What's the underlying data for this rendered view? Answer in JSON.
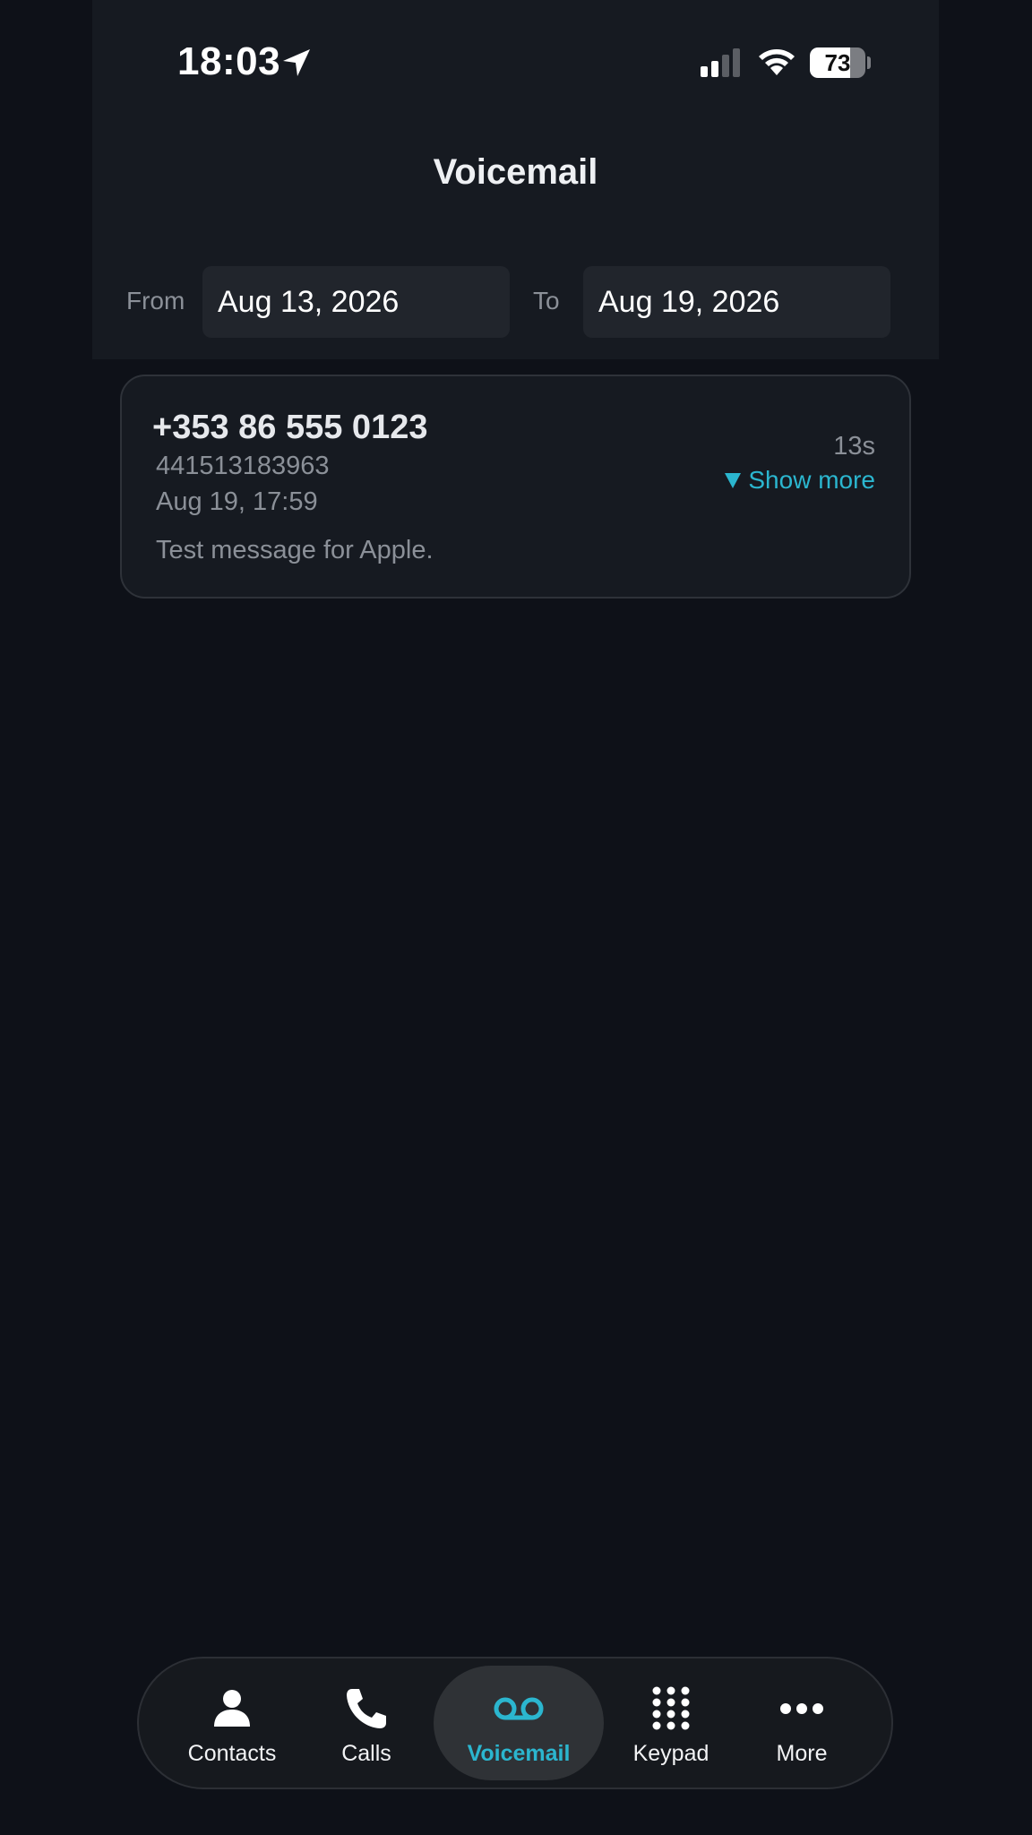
{
  "status_bar": {
    "time": "18:03",
    "battery_percent": "73",
    "battery_level": 0.73
  },
  "header": {
    "title": "Voicemail"
  },
  "filter": {
    "from_label": "From",
    "from_value": "Aug 13, 2026",
    "to_label": "To",
    "to_value": "Aug 19, 2026"
  },
  "voicemails": [
    {
      "number": "+353 86 555 0123",
      "line": "441513183963",
      "datetime": "Aug 19, 17:59",
      "duration": "13s",
      "show_more": "Show more",
      "transcript": "Test message for Apple."
    }
  ],
  "tabs": [
    {
      "label": "Contacts",
      "icon": "person-icon"
    },
    {
      "label": "Calls",
      "icon": "phone-icon"
    },
    {
      "label": "Voicemail",
      "icon": "voicemail-icon",
      "active": true
    },
    {
      "label": "Keypad",
      "icon": "keypad-icon"
    },
    {
      "label": "More",
      "icon": "more-icon"
    }
  ],
  "colors": {
    "accent": "#2bb6cf",
    "background": "#0e1118",
    "panel": "#161a21"
  }
}
